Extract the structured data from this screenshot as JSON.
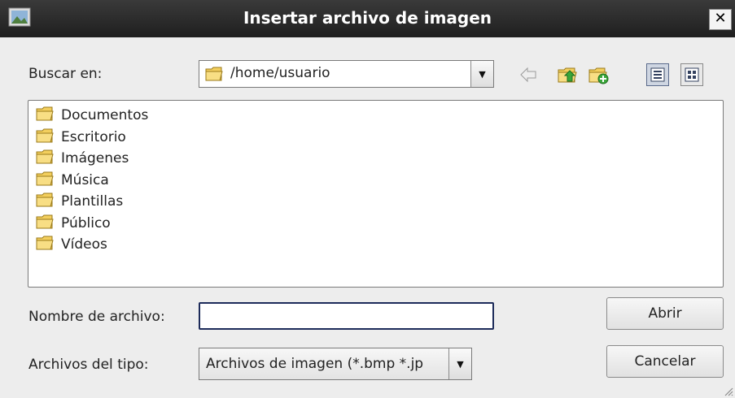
{
  "window": {
    "title": "Insertar archivo de imagen",
    "close_glyph": "✕"
  },
  "lookin": {
    "label": "Buscar en:",
    "path": "/home/usuario"
  },
  "toolbar": {
    "icons": [
      "back-arrow-icon",
      "parent-folder-icon",
      "new-folder-icon",
      "list-view-icon",
      "detail-view-icon"
    ],
    "active_view": "list-view"
  },
  "files": {
    "items": [
      {
        "name": "Documentos"
      },
      {
        "name": "Escritorio"
      },
      {
        "name": "Imágenes"
      },
      {
        "name": "Música"
      },
      {
        "name": "Plantillas"
      },
      {
        "name": "Público"
      },
      {
        "name": "Vídeos"
      }
    ]
  },
  "filename": {
    "label": "Nombre de archivo:",
    "value": ""
  },
  "filetype": {
    "label": "Archivos del tipo:",
    "value": "Archivos de imagen (*.bmp *.jp"
  },
  "buttons": {
    "open": "Abrir",
    "cancel": "Cancelar"
  },
  "colors": {
    "title_bg": "#2b2b2b",
    "folder": "#f3cf5e",
    "accent_green": "#3aa63a",
    "input_border": "#1d2b5a"
  }
}
